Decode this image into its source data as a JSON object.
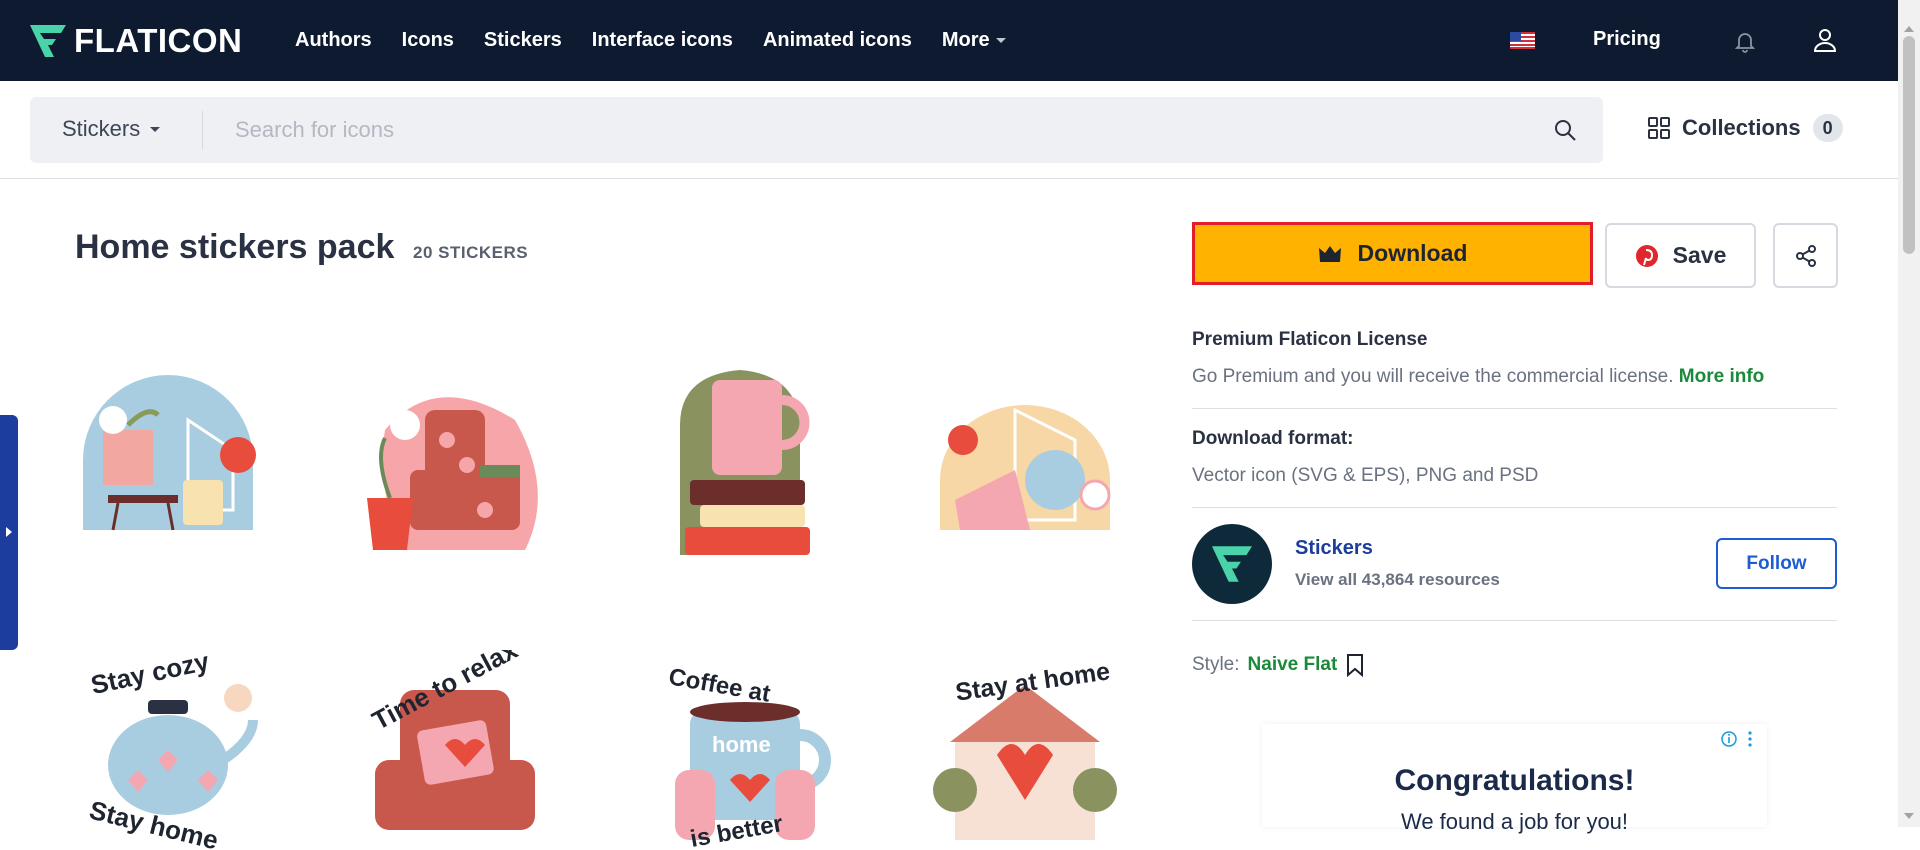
{
  "nav": {
    "logo_text": "FLATICON",
    "links": [
      "Authors",
      "Icons",
      "Stickers",
      "Interface icons",
      "Animated icons"
    ],
    "more_label": "More",
    "pricing_label": "Pricing"
  },
  "search": {
    "type_label": "Stickers",
    "placeholder": "Search for icons",
    "collections_label": "Collections",
    "collections_count": "0"
  },
  "pack": {
    "title": "Home stickers pack",
    "count_label": "20 STICKERS"
  },
  "stickers_row1": [
    "home-window-sticker",
    "armchair-plant-sticker",
    "mug-books-sticker",
    "watering-can-sticker"
  ],
  "stickers_row2": [
    {
      "text1": "Stay cozy",
      "text2": "Stay home"
    },
    {
      "text1": "Time to relax",
      "text2": ""
    },
    {
      "text1": "Coffee at",
      "text2": "home",
      "text3": "is better"
    },
    {
      "text1": "Stay at home",
      "text2": ""
    }
  ],
  "actions": {
    "download_label": "Download",
    "save_label": "Save"
  },
  "license": {
    "title": "Premium Flaticon License",
    "text": "Go Premium and you will receive the commercial license.",
    "more_label": "More info"
  },
  "format": {
    "title": "Download format:",
    "text": "Vector icon (SVG & EPS), PNG and PSD"
  },
  "author": {
    "name": "Stickers",
    "sub": "View all 43,864 resources",
    "follow_label": "Follow"
  },
  "style": {
    "label": "Style:",
    "value": "Naive Flat"
  },
  "ad": {
    "title": "Congratulations!",
    "subtitle": "We found a job for you!"
  },
  "colors": {
    "nav_bg": "#0e1a2f",
    "download_bg": "#ffb300",
    "highlight_border": "#e11d2a",
    "accent_green": "#1a8a3a",
    "accent_blue": "#1d5cd1"
  }
}
